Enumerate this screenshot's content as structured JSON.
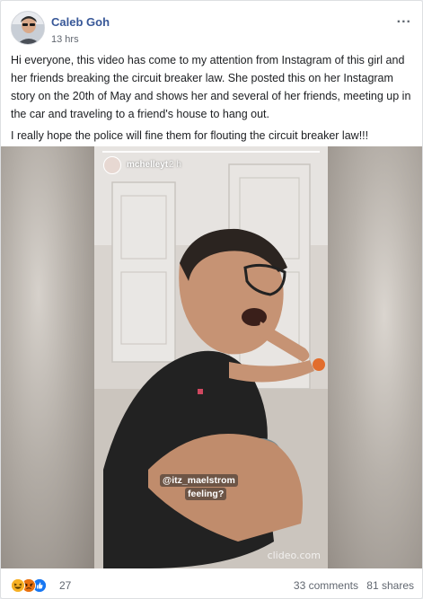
{
  "post": {
    "author": "Caleb Goh",
    "time": "13 hrs",
    "more": "...",
    "paragraphs": [
      "Hi everyone, this video has come to my attention from Instagram of this girl and her friends breaking the circuit breaker law. She posted this on her Instagram story on the 20th of May and shows her and several of her friends, meeting up in the car and traveling to a friend's house to hang out.",
      "I really hope the police will fine them for flouting the circuit breaker law!!!"
    ]
  },
  "video": {
    "story_user": "mchelleyt",
    "story_time": "2 h",
    "tag_user": "@itz_maelstrom",
    "tag_feeling": "feeling?",
    "watermark": "clideo.com"
  },
  "footer": {
    "reaction_icons": [
      "laugh-react-icon",
      "angry-react-icon",
      "like-react-icon"
    ],
    "reaction_count": "27",
    "comments": "33 comments",
    "shares": "81 shares"
  },
  "colors": {
    "author_link": "#385898",
    "meta_text": "#616770",
    "like_blue": "#1877f2",
    "laugh_yellow": "#f7b125",
    "angry_orange": "#e9710f"
  }
}
